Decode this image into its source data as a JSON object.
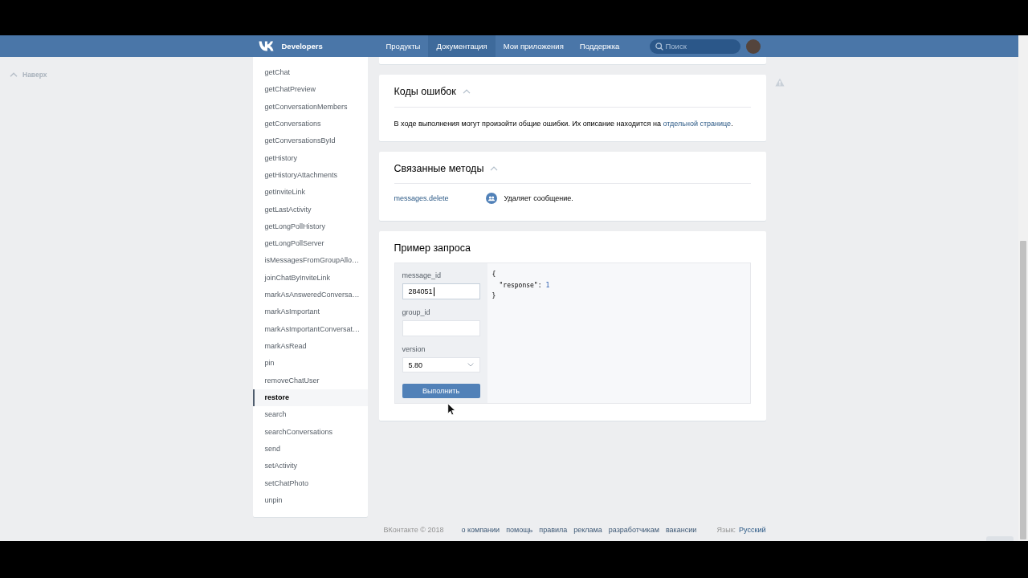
{
  "header": {
    "brand": "Developers",
    "nav": [
      {
        "label": "Продукты",
        "selected": false
      },
      {
        "label": "Документация",
        "selected": true
      },
      {
        "label": "Мои приложения",
        "selected": false
      },
      {
        "label": "Поддержка",
        "selected": false
      }
    ],
    "search": {
      "placeholder": "Поиск"
    }
  },
  "back_to_top": "Наверх",
  "sidebar": {
    "items": [
      {
        "label": "getChat",
        "selected": false
      },
      {
        "label": "getChatPreview",
        "selected": false
      },
      {
        "label": "getConversationMembers",
        "selected": false
      },
      {
        "label": "getConversations",
        "selected": false
      },
      {
        "label": "getConversationsById",
        "selected": false
      },
      {
        "label": "getHistory",
        "selected": false
      },
      {
        "label": "getHistoryAttachments",
        "selected": false
      },
      {
        "label": "getInviteLink",
        "selected": false
      },
      {
        "label": "getLastActivity",
        "selected": false
      },
      {
        "label": "getLongPollHistory",
        "selected": false
      },
      {
        "label": "getLongPollServer",
        "selected": false
      },
      {
        "label": "isMessagesFromGroupAllo…",
        "selected": false
      },
      {
        "label": "joinChatByInviteLink",
        "selected": false
      },
      {
        "label": "markAsAnsweredConversa…",
        "selected": false
      },
      {
        "label": "markAsImportant",
        "selected": false
      },
      {
        "label": "markAsImportantConversat…",
        "selected": false
      },
      {
        "label": "markAsRead",
        "selected": false
      },
      {
        "label": "pin",
        "selected": false
      },
      {
        "label": "removeChatUser",
        "selected": false
      },
      {
        "label": "restore",
        "selected": true
      },
      {
        "label": "search",
        "selected": false
      },
      {
        "label": "searchConversations",
        "selected": false
      },
      {
        "label": "send",
        "selected": false
      },
      {
        "label": "setActivity",
        "selected": false
      },
      {
        "label": "setChatPhoto",
        "selected": false
      },
      {
        "label": "unpin",
        "selected": false
      }
    ]
  },
  "sections": [
    {
      "kind": "errors",
      "title": "Коды ошибок",
      "expanded": true,
      "text": "В ходе выполнения могут произойти общие ошибки. Их описание находится на ",
      "link": "отдельной странице",
      "text_end": "."
    },
    {
      "kind": "related",
      "title": "Связанные методы",
      "expanded": true,
      "methods": [
        {
          "name": "messages.delete",
          "description": "Удаляет сообщение."
        }
      ]
    },
    {
      "kind": "example",
      "title": "Пример запроса",
      "fields": [
        {
          "label": "message_id",
          "kind": "text",
          "value": "284051",
          "focused": true
        },
        {
          "label": "group_id",
          "kind": "text",
          "focused": false
        },
        {
          "label": "version",
          "kind": "select",
          "value": "5.80",
          "focused": false
        }
      ],
      "button": "Выполнить",
      "response": {
        "open": "{",
        "entries": [
          {
            "key": "\"response\":",
            "value": "1"
          }
        ],
        "close": "}"
      }
    }
  ],
  "footer": {
    "copyright": "ВКонтакте © 2018",
    "links": [
      "о компании",
      "помощь",
      "правила",
      "реклама",
      "разработчикам",
      "вакансии"
    ],
    "language_label": "Язык:",
    "language": "Русский"
  }
}
